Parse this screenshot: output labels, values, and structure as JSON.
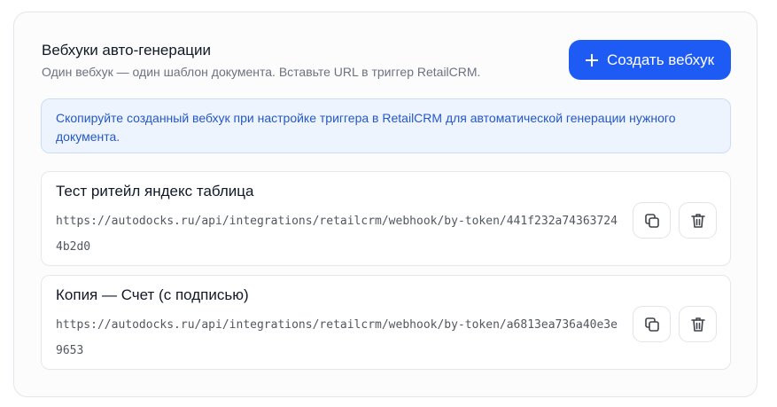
{
  "header": {
    "title": "Вебхуки авто-генерации",
    "subtitle": "Один вебхук — один шаблон документа. Вставьте URL в триггер RetailCRM.",
    "create_button_label": "Создать вебхук"
  },
  "info_banner": {
    "text": "Скопируйте созданный вебхук при настройке триггера в RetailCRM для автоматической генерации нужного документа."
  },
  "webhooks": [
    {
      "name": "Тест ритейл яндекс таблица",
      "url": "https://autodocks.ru/api/integrations/retailcrm/webhook/by-token/441f232a743637244b2d0"
    },
    {
      "name": "Копия — Счет (с подписью)",
      "url": "https://autodocks.ru/api/integrations/retailcrm/webhook/by-token/a6813ea736a40e3e9653"
    }
  ],
  "icons": {
    "create": "plus-icon",
    "copy": "copy-icon",
    "delete": "trash-icon"
  },
  "colors": {
    "accent": "#1d5bf4",
    "info_bg": "#eef4fd",
    "info_text": "#2458c7"
  }
}
